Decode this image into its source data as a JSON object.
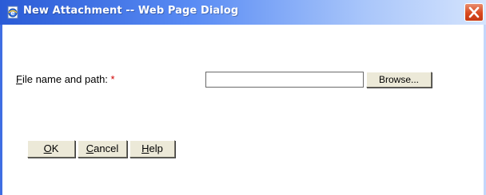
{
  "window": {
    "title": "New Attachment -- Web Page Dialog",
    "icon": "ie-page-icon",
    "close_icon": "close-x-icon",
    "titlebar_color": "#2a5bd6",
    "close_color": "#d8491f"
  },
  "form": {
    "file_label_mnemonic": "F",
    "file_label_rest": "ile name and path: ",
    "required_marker": "*",
    "file_value": "",
    "browse_label": "Browse..."
  },
  "buttons": {
    "ok": {
      "mnemonic": "O",
      "rest": "K"
    },
    "cancel": {
      "mnemonic": "C",
      "rest": "ancel"
    },
    "help": {
      "mnemonic": "H",
      "rest": "elp"
    }
  }
}
